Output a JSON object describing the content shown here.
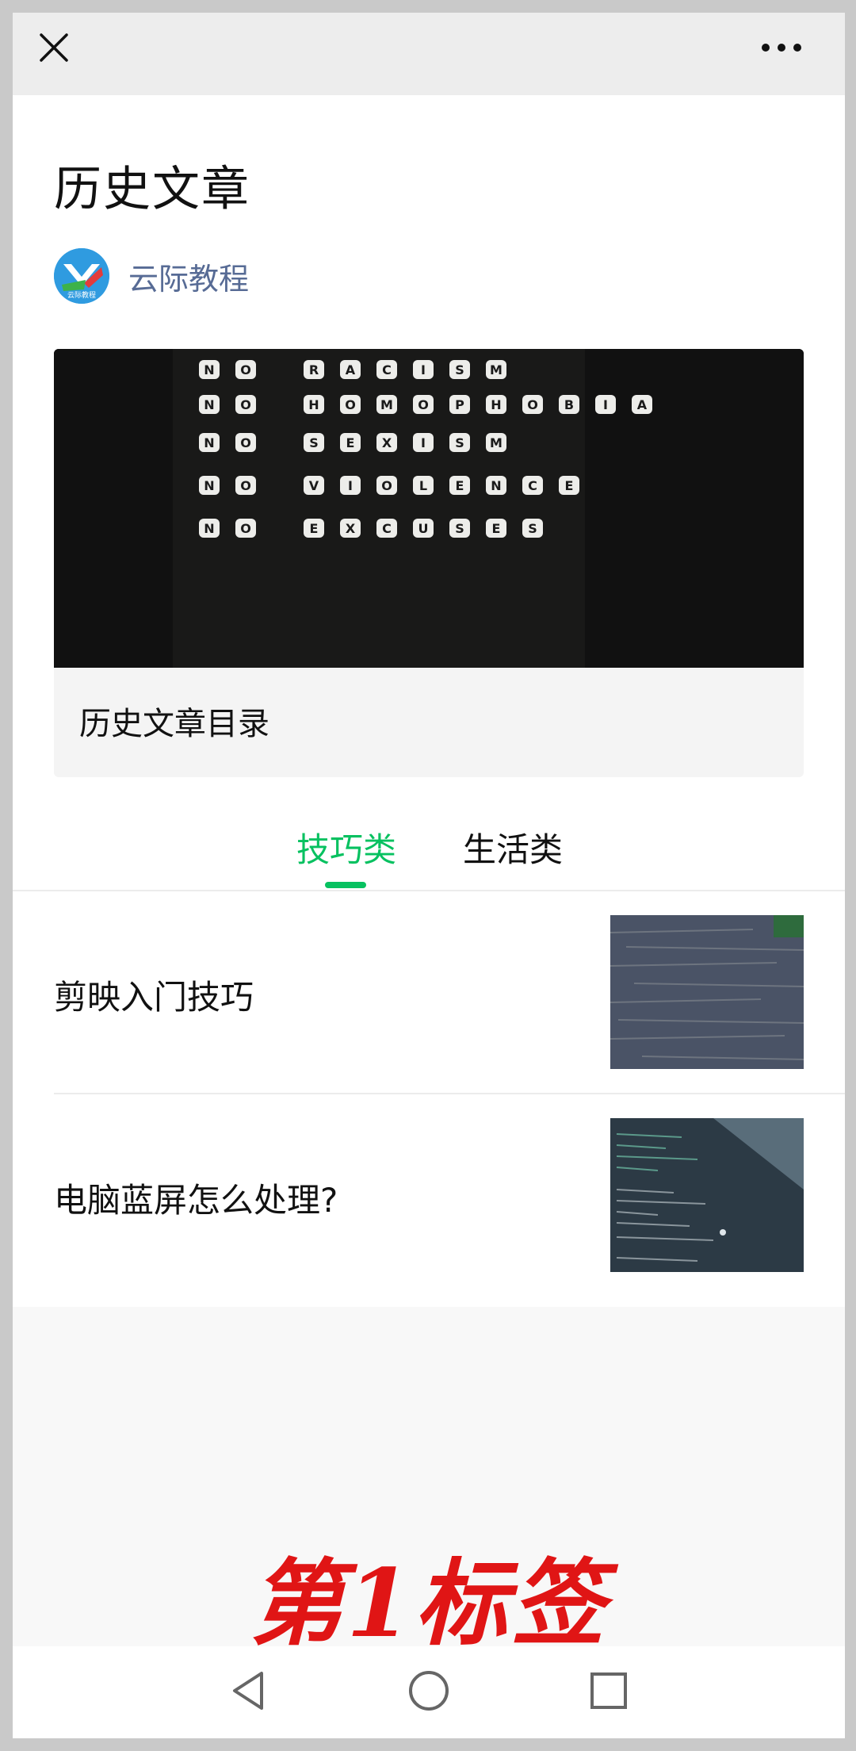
{
  "topbar": {
    "close_icon": "close-icon",
    "more_icon": "more-icon"
  },
  "article": {
    "title": "历史文章",
    "account_name": "云际教程",
    "avatar_label": "云际教程"
  },
  "banner": {
    "image_rows": [
      "NO RACISM",
      "NO HOMOPHOBIA",
      "NO SEXISM",
      "NO VIOLENCE",
      "NO EXCUSES"
    ],
    "caption": "历史文章目录"
  },
  "tabs": [
    {
      "label": "技巧类",
      "active": true
    },
    {
      "label": "生活类",
      "active": false
    }
  ],
  "list": [
    {
      "title": "剪映入门技巧",
      "thumb": "wood-texture-thumbnail"
    },
    {
      "title": "电脑蓝屏怎么处理?",
      "thumb": "code-screen-thumbnail"
    }
  ],
  "watermark": "第1标签",
  "colors": {
    "accent": "#07c160",
    "account_name": "#576b95",
    "watermark": "#e01515"
  },
  "navbar": {
    "back_icon": "back-triangle-icon",
    "home_icon": "home-circle-icon",
    "recent_icon": "recent-square-icon"
  }
}
